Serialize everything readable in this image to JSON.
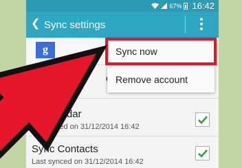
{
  "status_bar": {
    "battery": "67%",
    "time": "16:42"
  },
  "app_bar": {
    "back_icon": "chevron-left-icon",
    "title": "Sync settings",
    "overflow_icon": "more-vertical-icon"
  },
  "account": {
    "icon": "google-icon",
    "letter": "g"
  },
  "menu": {
    "items": [
      {
        "label": "Sync now"
      },
      {
        "label": "Remove account"
      }
    ]
  },
  "sync_items": [
    {
      "title": "data",
      "subtitle": "",
      "checked": true
    },
    {
      "title": "c Calendar",
      "subtitle": "ast synced on 31/12/2014 16:42",
      "checked": true
    },
    {
      "title": "Sync Contacts",
      "subtitle": "Last synced on 31/12/2014 16:42",
      "checked": true
    }
  ],
  "colors": {
    "status_bar": "#2d9ab3",
    "app_bar": "#2fa7c3",
    "highlight": "#e5152a",
    "arrow": "#e5152a",
    "check": "#2aa13e",
    "background": "#c2d6a4"
  }
}
